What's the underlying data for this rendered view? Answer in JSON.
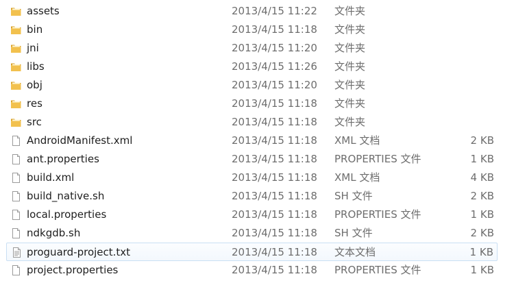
{
  "files": [
    {
      "name": "assets",
      "date": "2013/4/15 11:22",
      "type": "文件夹",
      "size": "",
      "icon": "folder-icon"
    },
    {
      "name": "bin",
      "date": "2013/4/15 11:18",
      "type": "文件夹",
      "size": "",
      "icon": "folder-icon"
    },
    {
      "name": "jni",
      "date": "2013/4/15 11:20",
      "type": "文件夹",
      "size": "",
      "icon": "folder-icon"
    },
    {
      "name": "libs",
      "date": "2013/4/15 11:26",
      "type": "文件夹",
      "size": "",
      "icon": "folder-icon"
    },
    {
      "name": "obj",
      "date": "2013/4/15 11:20",
      "type": "文件夹",
      "size": "",
      "icon": "folder-icon"
    },
    {
      "name": "res",
      "date": "2013/4/15 11:18",
      "type": "文件夹",
      "size": "",
      "icon": "folder-icon"
    },
    {
      "name": "src",
      "date": "2013/4/15 11:18",
      "type": "文件夹",
      "size": "",
      "icon": "folder-icon"
    },
    {
      "name": "AndroidManifest.xml",
      "date": "2013/4/15 11:18",
      "type": "XML 文档",
      "size": "2 KB",
      "icon": "file-icon"
    },
    {
      "name": "ant.properties",
      "date": "2013/4/15 11:18",
      "type": "PROPERTIES 文件",
      "size": "1 KB",
      "icon": "file-icon"
    },
    {
      "name": "build.xml",
      "date": "2013/4/15 11:18",
      "type": "XML 文档",
      "size": "4 KB",
      "icon": "file-icon"
    },
    {
      "name": "build_native.sh",
      "date": "2013/4/15 11:18",
      "type": "SH 文件",
      "size": "2 KB",
      "icon": "file-icon"
    },
    {
      "name": "local.properties",
      "date": "2013/4/15 11:18",
      "type": "PROPERTIES 文件",
      "size": "1 KB",
      "icon": "file-icon"
    },
    {
      "name": "ndkgdb.sh",
      "date": "2013/4/15 11:18",
      "type": "SH 文件",
      "size": "2 KB",
      "icon": "file-icon"
    },
    {
      "name": "proguard-project.txt",
      "date": "2013/4/15 11:18",
      "type": "文本文档",
      "size": "1 KB",
      "icon": "text-file-icon"
    },
    {
      "name": "project.properties",
      "date": "2013/4/15 11:18",
      "type": "PROPERTIES 文件",
      "size": "1 KB",
      "icon": "file-icon"
    }
  ],
  "colors": {
    "folder": "#f2c14e",
    "folder_dark": "#d9a22b",
    "hover_border": "#c9dff3",
    "meta_text": "#6d6d6d"
  }
}
